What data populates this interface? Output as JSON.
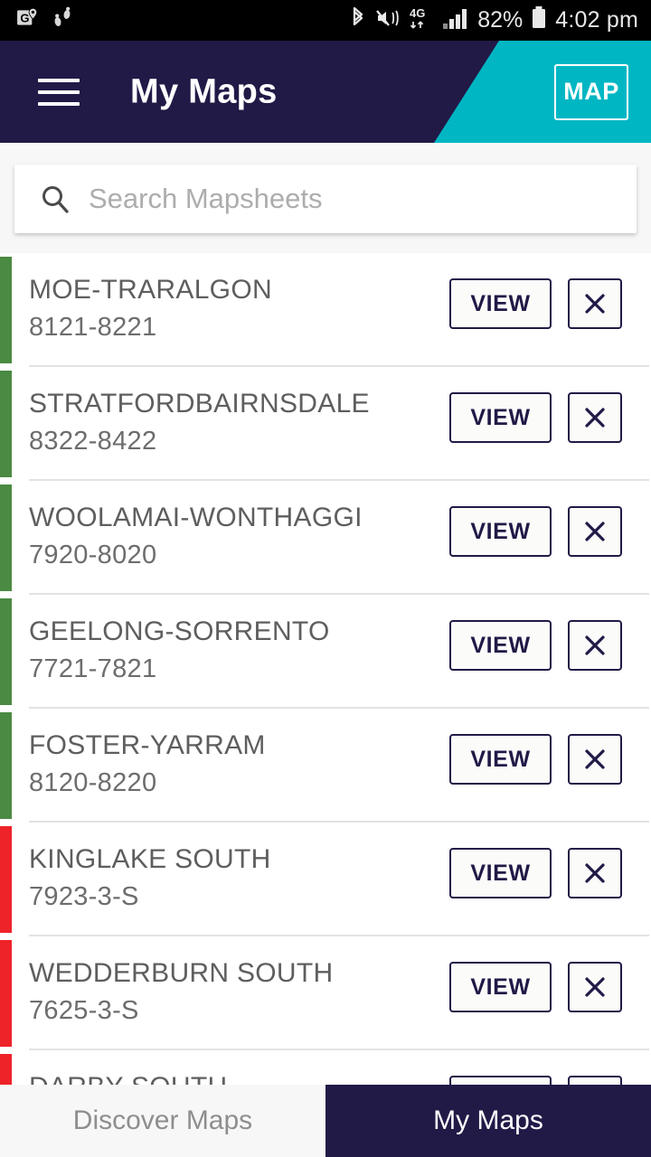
{
  "statusbar": {
    "left_icons": [
      "google-maps-icon",
      "footsteps-icon"
    ],
    "right_icons": [
      "bluetooth-icon",
      "mute-vibrate-icon",
      "4g-data-icon",
      "signal-bars-icon",
      "battery-icon"
    ],
    "network_label": "4G",
    "battery_percent": "82%",
    "time": "4:02 pm"
  },
  "header": {
    "menu_icon": "hamburger-menu-icon",
    "title": "My Maps",
    "map_button_label": "MAP",
    "navy": "#211a47",
    "teal": "#00b6c3"
  },
  "search": {
    "icon": "search-icon",
    "value": "",
    "placeholder": "Search Mapsheets"
  },
  "list": {
    "status_colors": {
      "downloaded": "#4a8a42",
      "not_downloaded": "#ee2329"
    },
    "view_label": "VIEW",
    "remove_icon": "close-x-icon",
    "items": [
      {
        "title": "MOE-TRARALGON",
        "code": "8121-8221",
        "status": "downloaded",
        "color": "#4a8a42"
      },
      {
        "title": "STRATFORDBAIRNSDALE",
        "code": "8322-8422",
        "status": "downloaded",
        "color": "#4a8a42"
      },
      {
        "title": "WOOLAMAI-WONTHAGGI",
        "code": "7920-8020",
        "status": "downloaded",
        "color": "#4a8a42"
      },
      {
        "title": "GEELONG-SORRENTO",
        "code": "7721-7821",
        "status": "downloaded",
        "color": "#4a8a42"
      },
      {
        "title": "FOSTER-YARRAM",
        "code": "8120-8220",
        "status": "downloaded",
        "color": "#4a8a42"
      },
      {
        "title": "KINGLAKE SOUTH",
        "code": "7923-3-S",
        "status": "not_downloaded",
        "color": "#ee2329"
      },
      {
        "title": "WEDDERBURN SOUTH",
        "code": "7625-3-S",
        "status": "not_downloaded",
        "color": "#ee2329"
      },
      {
        "title": "DARBY SOUTH",
        "code": "",
        "status": "not_downloaded",
        "color": "#ee2329"
      }
    ]
  },
  "bottomnav": {
    "items": [
      {
        "label": "Discover Maps",
        "active": false
      },
      {
        "label": "My Maps",
        "active": true
      }
    ]
  }
}
